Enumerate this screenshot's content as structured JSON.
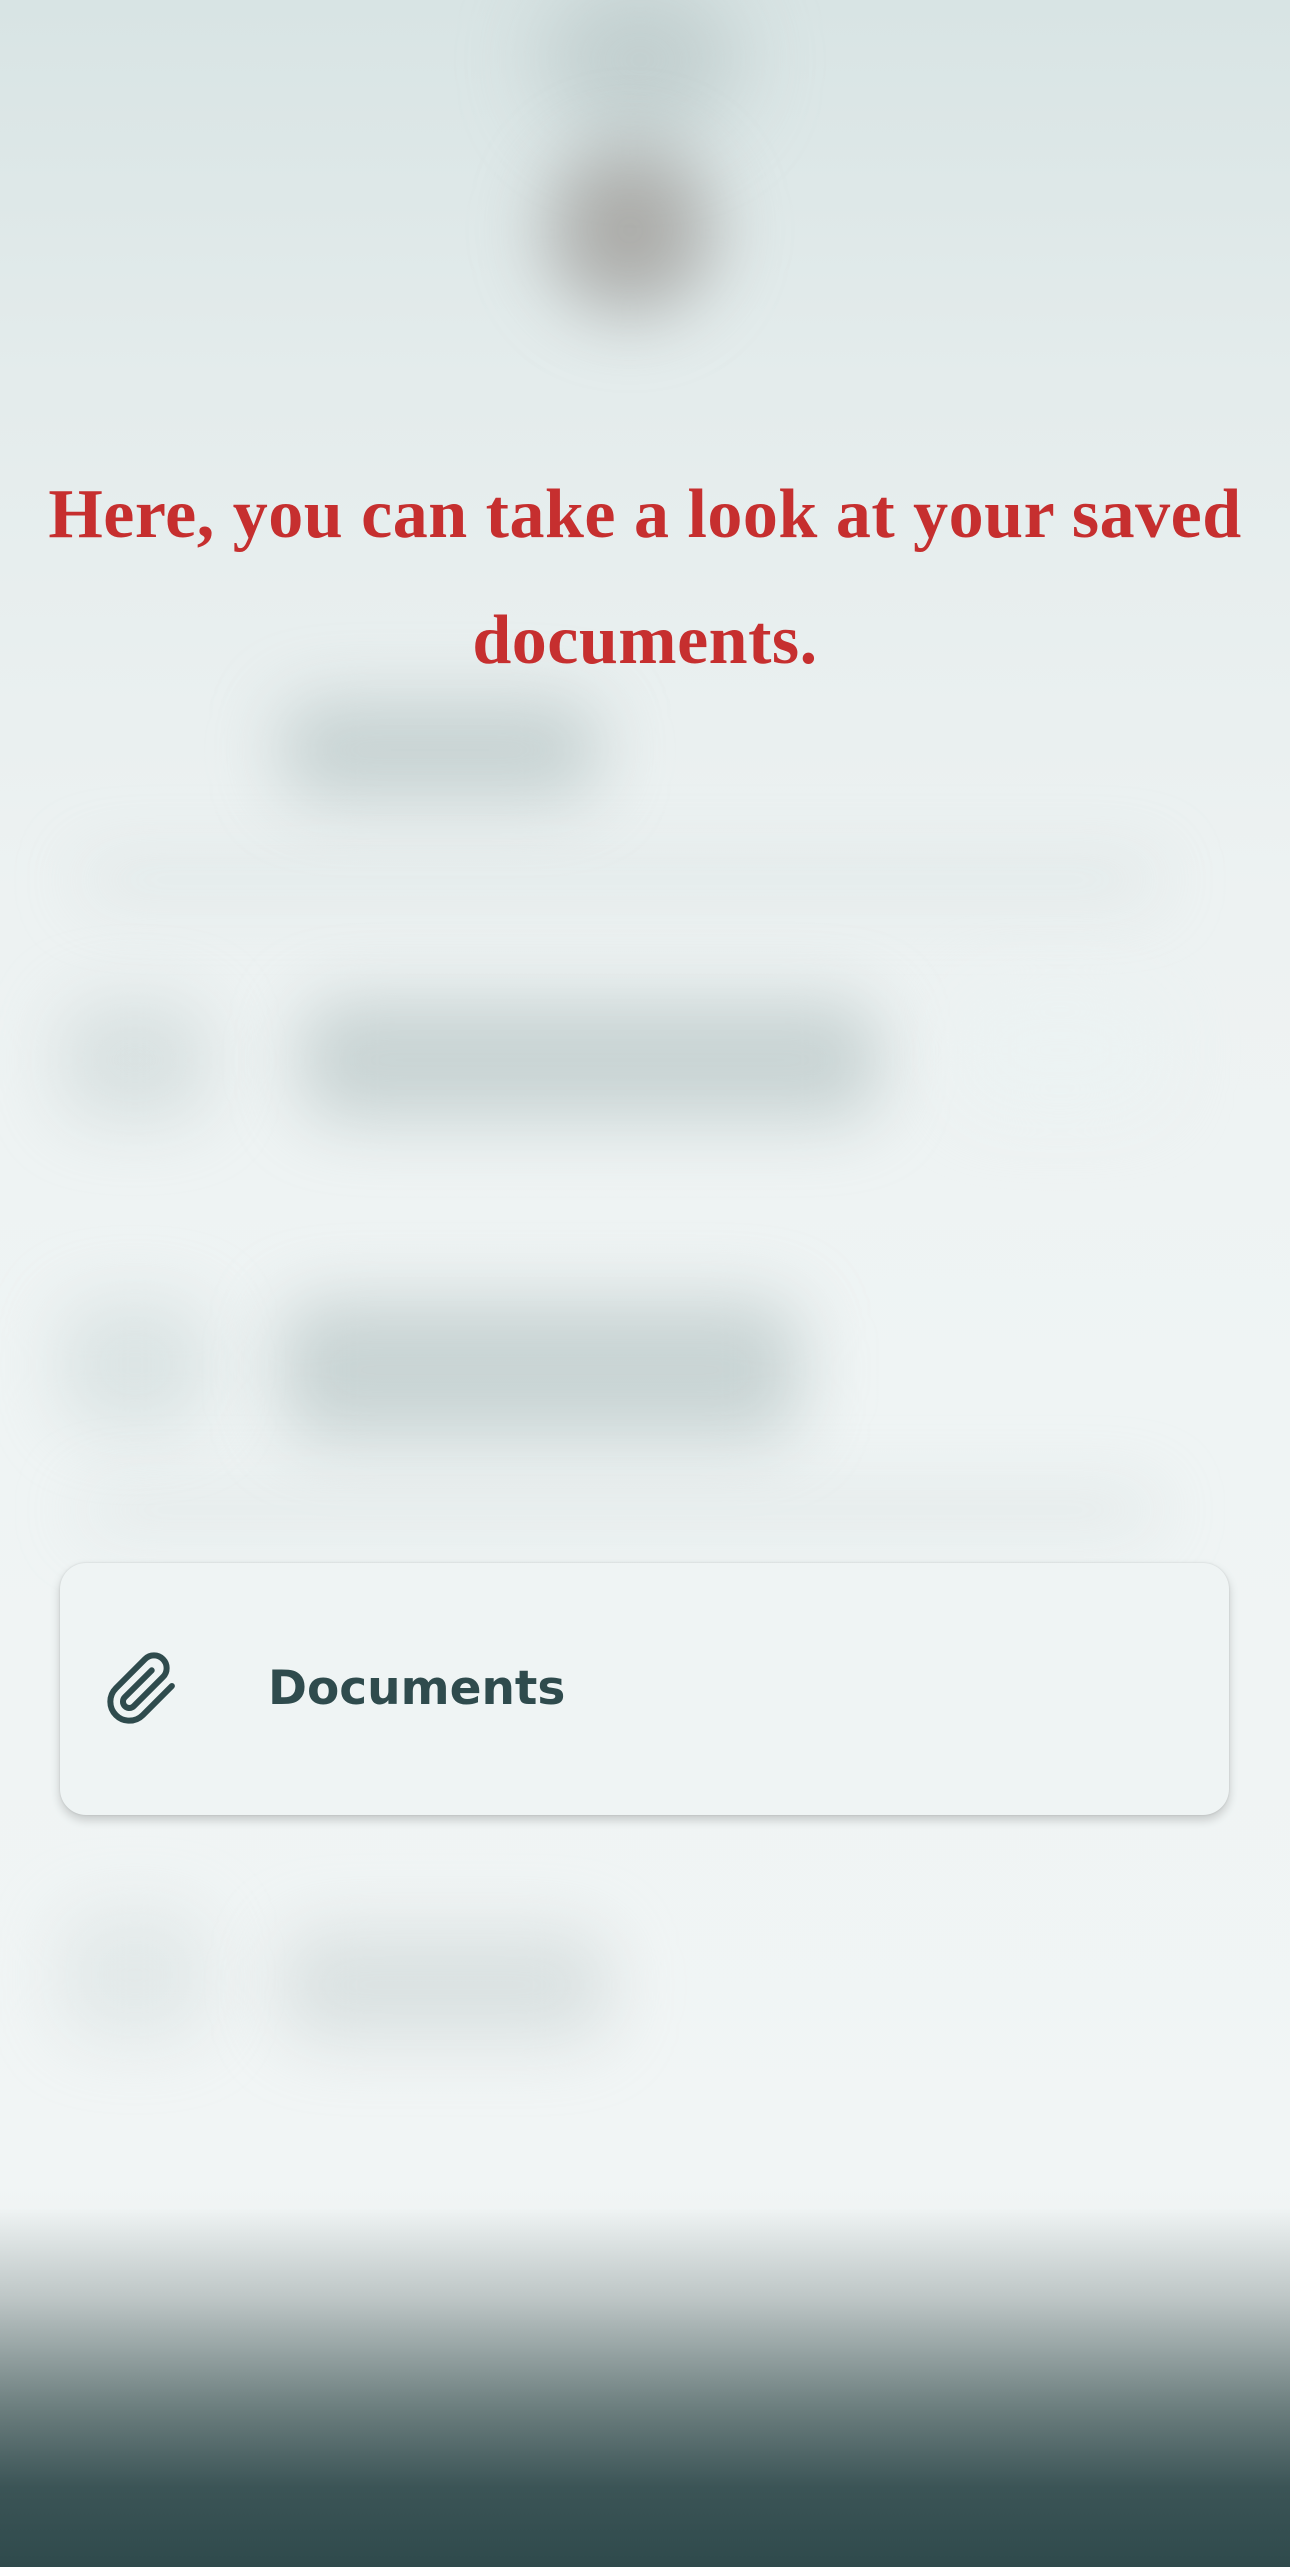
{
  "onboarding": {
    "message": "Here, you can take a look at your saved documents."
  },
  "highlighted_item": {
    "label": "Documents",
    "icon": "paperclip-icon"
  },
  "colors": {
    "message": "#c62f2f",
    "item_text": "#2f4b4d",
    "bottom_bar": "#2f4a4c"
  }
}
